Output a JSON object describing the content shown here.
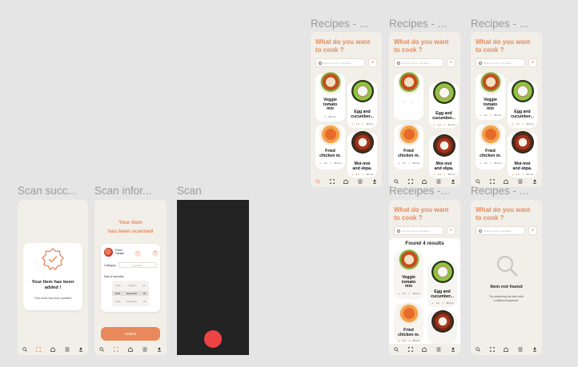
{
  "frames": {
    "recipes_a": {
      "title": "Recipes - ..."
    },
    "recipes_b": {
      "title": "Recipes - ..."
    },
    "recipes_c": {
      "title": "Recipes - ..."
    },
    "receipes_found": {
      "title": "Receipes -..."
    },
    "recipes_notfound": {
      "title": "Recipes - ..."
    },
    "scan_success": {
      "title": "Scan succ..."
    },
    "scan_info": {
      "title": "Scan infor..."
    },
    "scan": {
      "title": "Scan"
    }
  },
  "recipes": {
    "heading_line1": "What do you want",
    "heading_line2": "to cook ?",
    "search_placeholder": "Find for food or ingredient...",
    "add_label": "+",
    "cards": [
      {
        "name_l1": "Veggie",
        "name_l2": "tomato",
        "name_l3": "mix",
        "kcal": "1 h",
        "time": "35 min"
      },
      {
        "name_l1": "Egg and",
        "name_l2": "cucumber...",
        "name_l3": "",
        "kcal": "1 h",
        "time": "45 min"
      },
      {
        "name_l1": "Fried",
        "name_l2": "chicken m.",
        "name_l3": "",
        "kcal": "1 h",
        "time": "45 min"
      },
      {
        "name_l1": "Moi-moi",
        "name_l2": "and ekpa.",
        "name_l3": "",
        "kcal": "1 h",
        "time": "45 min"
      }
    ],
    "found_label": "Found  4 results",
    "not_found_title": "Item not found",
    "not_found_sub_l1": "Try searching the item with",
    "not_found_sub_l2": "a different keyword."
  },
  "scan_success": {
    "title_l1": "Your Item has been",
    "title_l2": "added !",
    "subtitle": "Your stock has been updated"
  },
  "scan_info": {
    "heading_l1": "Your Item",
    "heading_l2": "has been scanned",
    "item_name_l1": "Fresh",
    "item_name_l2": "Tomato",
    "category_label": "Category",
    "category_value": "Vegetables",
    "expiration_label": "Date of expiration",
    "date_rows": [
      [
        "2022",
        "August",
        "01"
      ],
      [
        "2023",
        "September",
        "02"
      ],
      [
        "2024",
        "November",
        "03"
      ]
    ],
    "date_rows_selected": 1,
    "submit_label": "Submit"
  },
  "colors": {
    "accent": "#e9885a",
    "record": "#ef4444",
    "bg": "#f2efe9",
    "canvas": "#e5e5e5"
  },
  "nav_icons": [
    "search-icon",
    "scan-icon",
    "home-icon",
    "list-icon",
    "profile-icon"
  ]
}
